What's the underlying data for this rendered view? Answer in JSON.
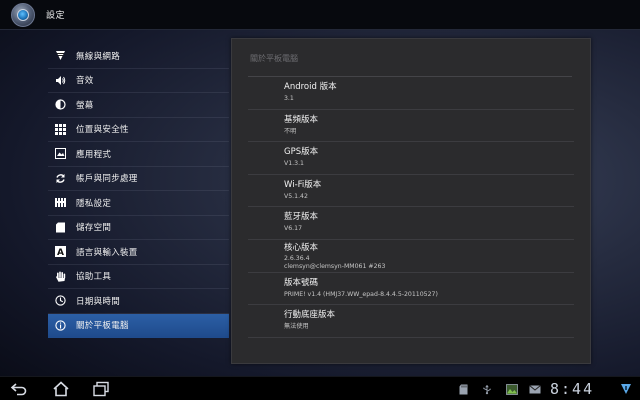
{
  "app": {
    "title": "設定",
    "icon": "settings-app-icon"
  },
  "sidebar": {
    "items": [
      {
        "label": "無線與網路",
        "icon": "wifi-icon"
      },
      {
        "label": "音效",
        "icon": "speaker-icon"
      },
      {
        "label": "螢幕",
        "icon": "brightness-icon"
      },
      {
        "label": "位置與安全性",
        "icon": "location-grid-icon"
      },
      {
        "label": "應用程式",
        "icon": "applications-icon"
      },
      {
        "label": "帳戶與同步處理",
        "icon": "sync-icon"
      },
      {
        "label": "隱私設定",
        "icon": "privacy-icon"
      },
      {
        "label": "儲存空間",
        "icon": "storage-icon"
      },
      {
        "label": "語言與輸入裝置",
        "icon": "language-icon"
      },
      {
        "label": "協助工具",
        "icon": "hand-icon"
      },
      {
        "label": "日期與時間",
        "icon": "clock-icon"
      },
      {
        "label": "關於平板電腦",
        "icon": "info-icon",
        "selected": true
      }
    ]
  },
  "panel": {
    "header": "關於平板電腦",
    "rows": [
      {
        "title": "Android 版本",
        "values": [
          "3.1"
        ]
      },
      {
        "title": "基頻版本",
        "values": [
          "不明"
        ]
      },
      {
        "title": "GPS版本",
        "values": [
          "V1.3.1"
        ]
      },
      {
        "title": "Wi-Fi版本",
        "values": [
          "V5.1.42"
        ]
      },
      {
        "title": "藍牙版本",
        "values": [
          "V6.17"
        ]
      },
      {
        "title": "核心版本",
        "values": [
          "2.6.36.4",
          "clemsyn@clemsyn-MM061 #263"
        ]
      },
      {
        "title": "版本號碼",
        "values": [
          "PRIME! v1.4 (HMJ37.WW_epad-8.4.4.5-20110527)"
        ]
      },
      {
        "title": "行動底座版本",
        "values": [
          "無法使用"
        ]
      }
    ]
  },
  "system_bar": {
    "clock": "8:44",
    "nav_icons": [
      "back-icon",
      "home-icon",
      "recent-apps-icon"
    ],
    "status_icons": [
      "sd-card-icon",
      "usb-debug-icon",
      "gallery-notification-icon",
      "mail-icon",
      "signal-icon"
    ]
  },
  "colors": {
    "selected_item": "#2c5fa6",
    "panel_bg": "#2b2b2d",
    "bar_bg": "#000000"
  }
}
